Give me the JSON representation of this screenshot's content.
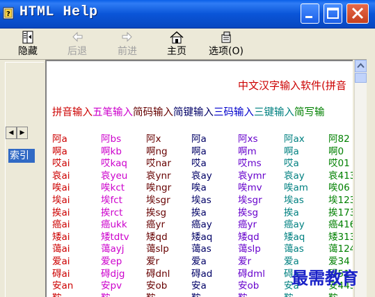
{
  "window": {
    "title": "HTML Help"
  },
  "toolbar": {
    "items": [
      {
        "label": "隐藏",
        "icon": "hide-pane-icon",
        "enabled": true
      },
      {
        "label": "后退",
        "icon": "back-arrow-icon",
        "enabled": false
      },
      {
        "label": "前进",
        "icon": "forward-arrow-icon",
        "enabled": false
      },
      {
        "label": "主页",
        "icon": "home-icon",
        "enabled": true
      },
      {
        "label": "选项(O)",
        "icon": "options-icon",
        "enabled": true
      }
    ]
  },
  "nav": {
    "left_arrow": "◀",
    "right_arrow": "▶",
    "index_tab": "索引"
  },
  "content": {
    "heading": "中文汉字输入软件(拼音",
    "methods": [
      {
        "text": "拼音输入",
        "color": "#cc0000"
      },
      {
        "text": "五笔输入",
        "color": "#cc00cc"
      },
      {
        "text": "简码输入",
        "color": "#660000"
      },
      {
        "text": "简键输入",
        "color": "#000066"
      },
      {
        "text": "三码输入",
        "color": "#0000cc"
      },
      {
        "text": "三键输入",
        "color": "#008080"
      },
      {
        "text": "简写输",
        "color": "#008000"
      }
    ],
    "column_colors": [
      "#cc0000",
      "#cc00cc",
      "#660000",
      "#000066",
      "#6600cc",
      "#008080",
      "#008000"
    ],
    "rows": [
      [
        "阿a",
        "阿bs",
        "阿x",
        "阿a",
        "阿xs",
        "阿ax",
        "阿82"
      ],
      [
        "啊a",
        "啊kb",
        "啊ng",
        "啊a",
        "啊m",
        "啊a",
        "啊0"
      ],
      [
        "哎ai",
        "哎kaq",
        "哎nar",
        "哎a",
        "哎ms",
        "哎a",
        "哎01"
      ],
      [
        "哀ai",
        "哀yeu",
        "哀ynr",
        "哀ay",
        "哀ymr",
        "哀ay",
        "哀413"
      ],
      [
        "唉ai",
        "唉kct",
        "唉ngr",
        "唉a",
        "唉mv",
        "唉am",
        "唉06"
      ],
      [
        "埃ai",
        "埃fct",
        "埃sgr",
        "埃as",
        "埃sgr",
        "埃as",
        "埃123"
      ],
      [
        "挨ai",
        "挨rct",
        "挨sg",
        "挨a",
        "挨sg",
        "挨a",
        "挨173"
      ],
      [
        "癌ai",
        "癌ukk",
        "癌yr",
        "癌ay",
        "癌yr",
        "癌ay",
        "癌416"
      ],
      [
        "矮ai",
        "矮tdtv",
        "矮qd",
        "矮aq",
        "矮qd",
        "矮aq",
        "矮313"
      ],
      [
        "蔼ai",
        "蔼ayj",
        "蔼slp",
        "蔼as",
        "蔼slp",
        "蔼as",
        "蔼124"
      ],
      [
        "爱ai",
        "爱ep",
        "爱r",
        "爱a",
        "爱r",
        "爱a",
        "爱34"
      ],
      [
        "碍ai",
        "碍djg",
        "碍dnl",
        "碍ad",
        "碍dml",
        "碍a",
        "碍51"
      ],
      [
        "安an",
        "安pv",
        "安ob",
        "安a",
        "安ob",
        "安a",
        "安443"
      ],
      [
        "鞍",
        "鞍",
        "鞍",
        "鞍",
        "鞍",
        "鞍",
        "鞍"
      ]
    ]
  },
  "watermark": "最需教育"
}
